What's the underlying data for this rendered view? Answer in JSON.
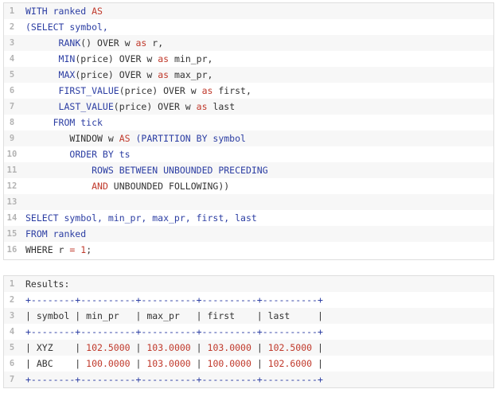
{
  "code": {
    "lines": [
      {
        "n": "1",
        "indent": "",
        "tokens": [
          {
            "t": "WITH ranked ",
            "c": "k"
          },
          {
            "t": "AS",
            "c": "s"
          }
        ]
      },
      {
        "n": "2",
        "indent": "",
        "tokens": [
          {
            "t": "(SELECT symbol,",
            "c": "k"
          }
        ]
      },
      {
        "n": "3",
        "indent": "      ",
        "tokens": [
          {
            "t": "RANK",
            "c": "k"
          },
          {
            "t": "() OVER w ",
            "c": "p"
          },
          {
            "t": "as",
            "c": "s"
          },
          {
            "t": " r,",
            "c": "p"
          }
        ]
      },
      {
        "n": "4",
        "indent": "      ",
        "tokens": [
          {
            "t": "MIN",
            "c": "k"
          },
          {
            "t": "(price) OVER w ",
            "c": "p"
          },
          {
            "t": "as",
            "c": "s"
          },
          {
            "t": " min_pr,",
            "c": "p"
          }
        ]
      },
      {
        "n": "5",
        "indent": "      ",
        "tokens": [
          {
            "t": "MAX",
            "c": "k"
          },
          {
            "t": "(price) OVER w ",
            "c": "p"
          },
          {
            "t": "as",
            "c": "s"
          },
          {
            "t": " max_pr,",
            "c": "p"
          }
        ]
      },
      {
        "n": "6",
        "indent": "      ",
        "tokens": [
          {
            "t": "FIRST_VALUE",
            "c": "k"
          },
          {
            "t": "(price) OVER w ",
            "c": "p"
          },
          {
            "t": "as",
            "c": "s"
          },
          {
            "t": " first,",
            "c": "p"
          }
        ]
      },
      {
        "n": "7",
        "indent": "      ",
        "tokens": [
          {
            "t": "LAST_VALUE",
            "c": "k"
          },
          {
            "t": "(price) OVER w ",
            "c": "p"
          },
          {
            "t": "as",
            "c": "s"
          },
          {
            "t": " last",
            "c": "p"
          }
        ]
      },
      {
        "n": "8",
        "indent": "     ",
        "tokens": [
          {
            "t": "FROM tick",
            "c": "k"
          }
        ]
      },
      {
        "n": "9",
        "indent": "        ",
        "tokens": [
          {
            "t": "WINDOW w ",
            "c": "p"
          },
          {
            "t": "AS",
            "c": "s"
          },
          {
            "t": " (PARTITION BY symbol",
            "c": "k"
          }
        ]
      },
      {
        "n": "10",
        "indent": "        ",
        "tokens": [
          {
            "t": "ORDER BY ts",
            "c": "k"
          }
        ]
      },
      {
        "n": "11",
        "indent": "            ",
        "tokens": [
          {
            "t": "ROWS BETWEEN UNBOUNDED PRECEDING",
            "c": "k"
          }
        ]
      },
      {
        "n": "12",
        "indent": "            ",
        "tokens": [
          {
            "t": "AND",
            "c": "s"
          },
          {
            "t": " UNBOUNDED FOLLOWING))",
            "c": "p"
          }
        ]
      },
      {
        "n": "13",
        "indent": "",
        "tokens": []
      },
      {
        "n": "14",
        "indent": "",
        "tokens": [
          {
            "t": "SELECT symbol, min_pr, max_pr, first, last",
            "c": "k"
          }
        ]
      },
      {
        "n": "15",
        "indent": "",
        "tokens": [
          {
            "t": "FROM ranked",
            "c": "k"
          }
        ]
      },
      {
        "n": "16",
        "indent": "",
        "tokens": [
          {
            "t": "WHERE r ",
            "c": "p"
          },
          {
            "t": "=",
            "c": "s"
          },
          {
            "t": " ",
            "c": "p"
          },
          {
            "t": "1",
            "c": "n"
          },
          {
            "t": ";",
            "c": "p"
          }
        ]
      }
    ]
  },
  "results": {
    "lines": [
      {
        "n": "1",
        "tokens": [
          {
            "t": "Results:",
            "c": "p"
          }
        ]
      },
      {
        "n": "2",
        "tokens": [
          {
            "t": "+--------+----------+----------+----------+----------+",
            "c": "b"
          }
        ]
      },
      {
        "n": "3",
        "tokens": [
          {
            "t": "| symbol | min_pr   | max_pr   | first    | last     |",
            "c": "p"
          }
        ]
      },
      {
        "n": "4",
        "tokens": [
          {
            "t": "+--------+----------+----------+----------+----------+",
            "c": "b"
          }
        ]
      },
      {
        "n": "5",
        "tokens": [
          {
            "t": "| XYZ    | ",
            "c": "p"
          },
          {
            "t": "102.5000",
            "c": "n"
          },
          {
            "t": " | ",
            "c": "p"
          },
          {
            "t": "103.0000",
            "c": "n"
          },
          {
            "t": " | ",
            "c": "p"
          },
          {
            "t": "103.0000",
            "c": "n"
          },
          {
            "t": " | ",
            "c": "p"
          },
          {
            "t": "102.5000",
            "c": "n"
          },
          {
            "t": " |",
            "c": "p"
          }
        ]
      },
      {
        "n": "6",
        "tokens": [
          {
            "t": "| ABC    | ",
            "c": "p"
          },
          {
            "t": "100.0000",
            "c": "n"
          },
          {
            "t": " | ",
            "c": "p"
          },
          {
            "t": "103.0000",
            "c": "n"
          },
          {
            "t": " | ",
            "c": "p"
          },
          {
            "t": "100.0000",
            "c": "n"
          },
          {
            "t": " | ",
            "c": "p"
          },
          {
            "t": "102.6000",
            "c": "n"
          },
          {
            "t": " |",
            "c": "p"
          }
        ]
      },
      {
        "n": "7",
        "tokens": [
          {
            "t": "+--------+----------+----------+----------+----------+",
            "c": "b"
          }
        ]
      }
    ]
  }
}
